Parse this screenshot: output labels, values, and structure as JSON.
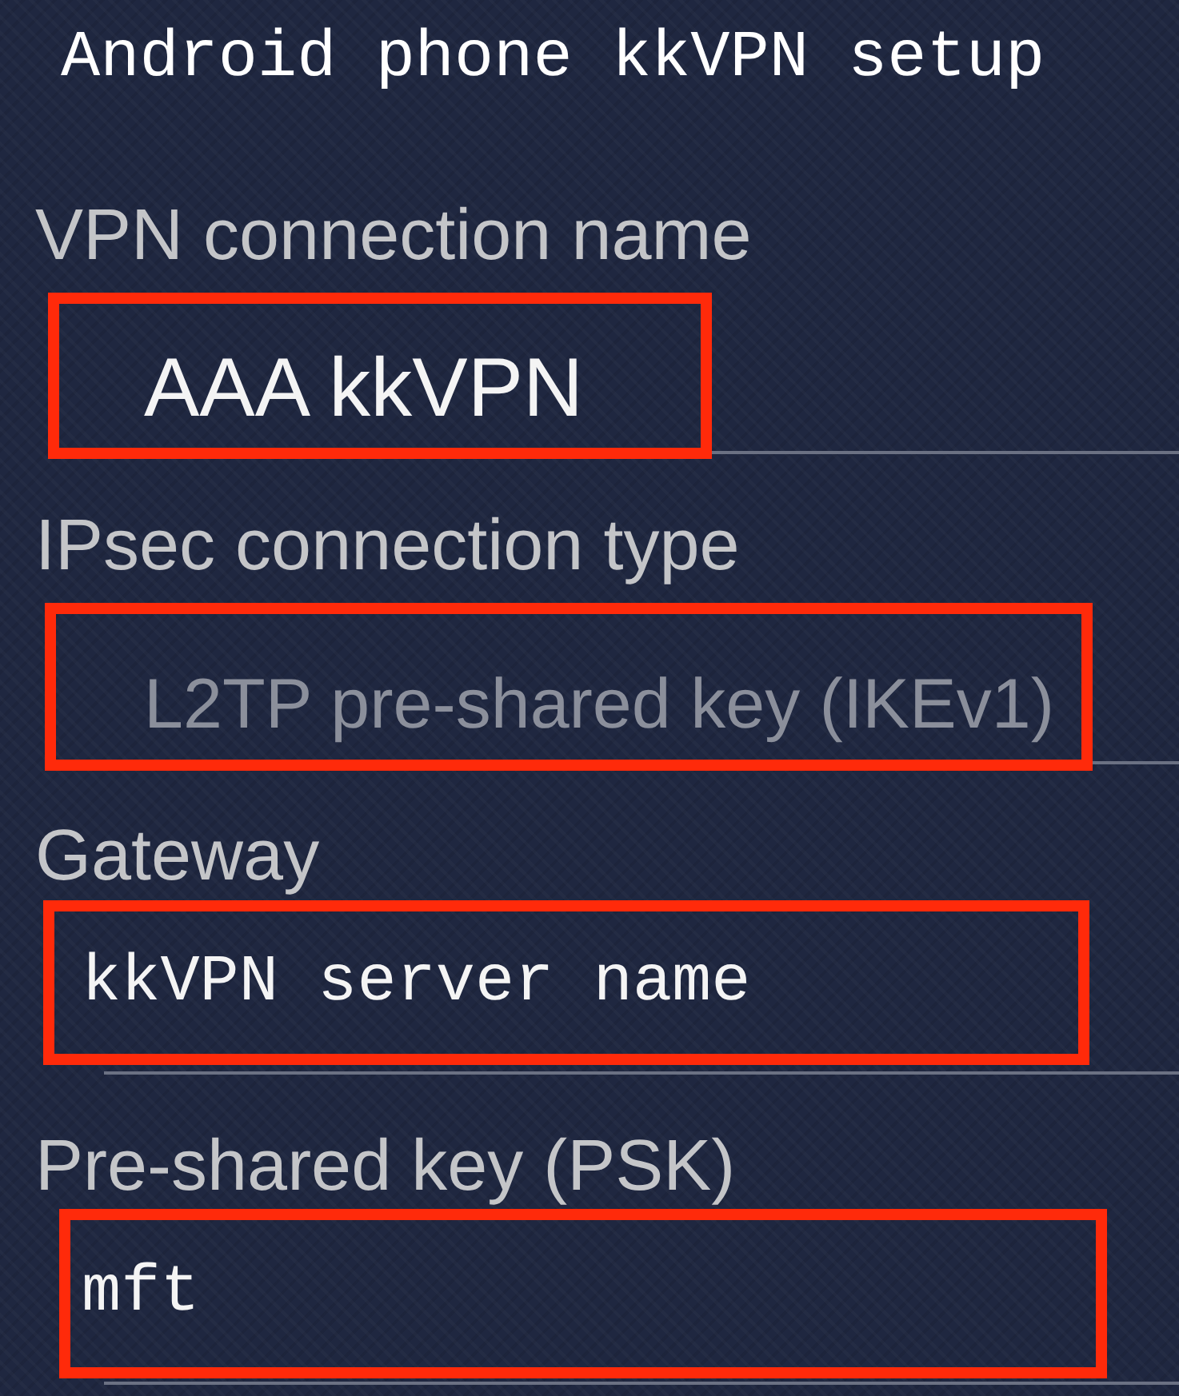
{
  "title": "Android phone kkVPN setup",
  "fields": [
    {
      "label": "VPN connection name",
      "value": "AAA kkVPN",
      "kind": "entry",
      "disabled": false,
      "highlighted": true
    },
    {
      "label": "IPsec connection type",
      "value": "L2TP pre-shared key (IKEv1)",
      "kind": "entry",
      "disabled": true,
      "highlighted": true
    },
    {
      "label": "Gateway",
      "value": "kkVPN server name",
      "kind": "note",
      "disabled": false,
      "highlighted": true
    },
    {
      "label": "Pre-shared key (PSK)",
      "value": "mft",
      "kind": "note",
      "disabled": false,
      "highlighted": true
    }
  ]
}
